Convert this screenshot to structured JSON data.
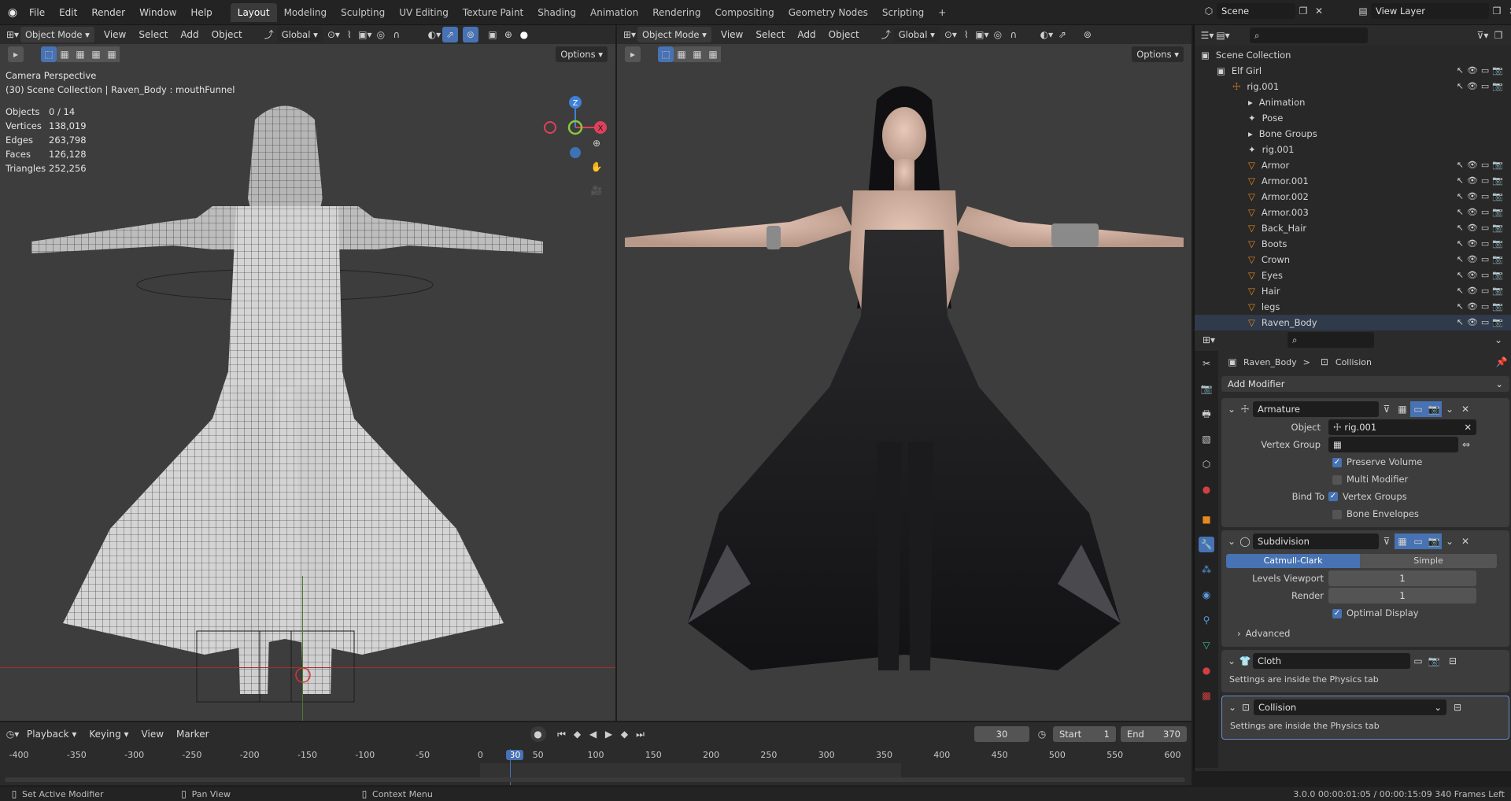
{
  "topbar": {
    "menus": [
      "File",
      "Edit",
      "Render",
      "Window",
      "Help"
    ],
    "workspaces": [
      "Layout",
      "Modeling",
      "Sculpting",
      "UV Editing",
      "Texture Paint",
      "Shading",
      "Animation",
      "Rendering",
      "Compositing",
      "Geometry Nodes",
      "Scripting"
    ],
    "active_workspace": "Layout",
    "add_tab": "+",
    "scene_label": "Scene",
    "view_layer_label": "View Layer"
  },
  "viewport_left": {
    "mode": "Object Mode",
    "menus": [
      "View",
      "Select",
      "Add",
      "Object"
    ],
    "orientation": "Global",
    "options": "Options",
    "title": "Camera Perspective",
    "context": "(30) Scene Collection | Raven_Body : mouthFunnel",
    "stats": [
      {
        "label": "Objects",
        "value": "0 / 14"
      },
      {
        "label": "Vertices",
        "value": "138,019"
      },
      {
        "label": "Edges",
        "value": "263,798"
      },
      {
        "label": "Faces",
        "value": "126,128"
      },
      {
        "label": "Triangles",
        "value": "252,256"
      }
    ],
    "gizmo": {
      "z": "Z",
      "x": "X"
    }
  },
  "viewport_right": {
    "mode": "Object Mode",
    "menus": [
      "View",
      "Select",
      "Add",
      "Object"
    ],
    "orientation": "Global",
    "options": "Options"
  },
  "outliner": {
    "search_placeholder": "",
    "rows": [
      {
        "label": "Scene Collection",
        "indent": 0,
        "icon": "▣"
      },
      {
        "label": "Elf Girl",
        "indent": 1,
        "icon": "▣"
      },
      {
        "label": "rig.001",
        "indent": 2,
        "icon": "☩"
      },
      {
        "label": "Animation",
        "indent": 3,
        "icon": "▸"
      },
      {
        "label": "Pose",
        "indent": 3,
        "icon": "✦"
      },
      {
        "label": "Bone Groups",
        "indent": 3,
        "icon": "▸"
      },
      {
        "label": "rig.001",
        "indent": 3,
        "icon": "✦"
      },
      {
        "label": "Armor",
        "indent": 3,
        "icon": "▽"
      },
      {
        "label": "Armor.001",
        "indent": 3,
        "icon": "▽"
      },
      {
        "label": "Armor.002",
        "indent": 3,
        "icon": "▽"
      },
      {
        "label": "Armor.003",
        "indent": 3,
        "icon": "▽"
      },
      {
        "label": "Back_Hair",
        "indent": 3,
        "icon": "▽"
      },
      {
        "label": "Boots",
        "indent": 3,
        "icon": "▽"
      },
      {
        "label": "Crown",
        "indent": 3,
        "icon": "▽"
      },
      {
        "label": "Eyes",
        "indent": 3,
        "icon": "▽"
      },
      {
        "label": "Hair",
        "indent": 3,
        "icon": "▽"
      },
      {
        "label": "legs",
        "indent": 3,
        "icon": "▽"
      },
      {
        "label": "Raven_Body",
        "indent": 3,
        "icon": "▽"
      }
    ]
  },
  "properties": {
    "breadcrumb_object": "Raven_Body",
    "breadcrumb_sep": ">",
    "breadcrumb_modifier": "Collision",
    "add_modifier": "Add Modifier",
    "armature": {
      "name": "Armature",
      "object_label": "Object",
      "object_value": "rig.001",
      "vertex_group_label": "Vertex Group",
      "preserve_volume": "Preserve Volume",
      "multi_modifier": "Multi Modifier",
      "bind_to_label": "Bind To",
      "vertex_groups": "Vertex Groups",
      "bone_envelopes": "Bone Envelopes"
    },
    "subdivision": {
      "name": "Subdivision",
      "catmull": "Catmull-Clark",
      "simple": "Simple",
      "levels_viewport_label": "Levels Viewport",
      "levels_viewport": "1",
      "render_label": "Render",
      "render": "1",
      "optimal_display": "Optimal Display",
      "advanced": "Advanced"
    },
    "cloth": {
      "name": "Cloth",
      "note": "Settings are inside the Physics tab"
    },
    "collision": {
      "name": "Collision",
      "note": "Settings are inside the Physics tab"
    }
  },
  "timeline": {
    "menus": [
      "Playback",
      "Keying",
      "View",
      "Marker"
    ],
    "current_frame": "30",
    "start_label": "Start",
    "start": "1",
    "end_label": "End",
    "end": "370",
    "ruler": [
      "-400",
      "-350",
      "-300",
      "-250",
      "-200",
      "-150",
      "-100",
      "-50",
      "0",
      "30",
      "50",
      "100",
      "150",
      "200",
      "250",
      "300",
      "350",
      "400",
      "450",
      "500",
      "550",
      "600"
    ]
  },
  "statusbar": {
    "left1": "Set Active Modifier",
    "left2": "Pan View",
    "left3": "Context Menu",
    "right": "3.0.0  00:00:01:05 / 00:00:15:09  340 Frames Left"
  },
  "colors": {
    "accent": "#4772b3",
    "orange": "#e8891e",
    "gizmo_x": "#e0405a",
    "gizmo_y": "#8ac83a",
    "gizmo_z": "#3f7fd6"
  }
}
